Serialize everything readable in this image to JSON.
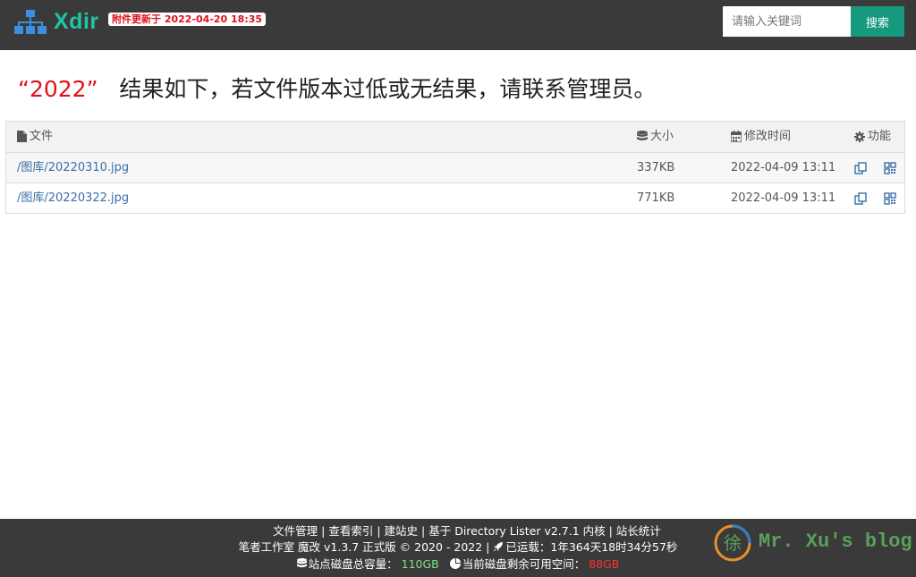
{
  "header": {
    "brand": "Xdir",
    "update_badge": "附件更新于 2022-04-20 18:35",
    "search_placeholder": "请输入关键词",
    "search_button": "搜索"
  },
  "result": {
    "keyword": "“2022”",
    "message": "结果如下，若文件版本过低或无结果，请联系管理员。"
  },
  "table": {
    "columns": {
      "file": "文件",
      "size": "大小",
      "mtime": "修改时间",
      "func": "功能"
    },
    "rows": [
      {
        "name": "/图库/20220310.jpg",
        "size": "337KB",
        "mtime": "2022-04-09 13:11"
      },
      {
        "name": "/图库/20220322.jpg",
        "size": "771KB",
        "mtime": "2022-04-09 13:11"
      }
    ]
  },
  "footer": {
    "links": [
      "文件管理",
      "查看索引",
      "建站史",
      "基于 Directory Lister v2.7.1 内核",
      "站长统计"
    ],
    "sep": " | ",
    "copyright": "笔者工作室 魔改 v1.3.7 正式版 © 2020 - 2022 | ",
    "runtime_label": "已运载：",
    "runtime": "1年364天18时34分57秒",
    "disk_total_label": "站点磁盘总容量：",
    "disk_total": "110GB",
    "disk_free_label": "当前磁盘剩余可用空间：",
    "disk_free": "88GB",
    "blog_name": "Mr. Xu's blog",
    "blog_logo_char": "徐"
  },
  "colors": {
    "topbar": "#3a3a3a",
    "brand": "#1ec6a4",
    "accent_button": "#159a80",
    "keyword": "#e0101a",
    "link": "#3a6fa8",
    "disk_total": "#7ee07e",
    "disk_free": "#ff3030"
  },
  "icons": {
    "logo": "sitemap-icon",
    "file_col": "file-icon",
    "size_col": "database-icon",
    "time_col": "calendar-icon",
    "func_col": "gear-icon",
    "copy": "copy-icon",
    "qr": "qrcode-icon",
    "runtime": "rocket-icon",
    "disk_total": "database-icon",
    "disk_free": "pie-chart-icon"
  }
}
